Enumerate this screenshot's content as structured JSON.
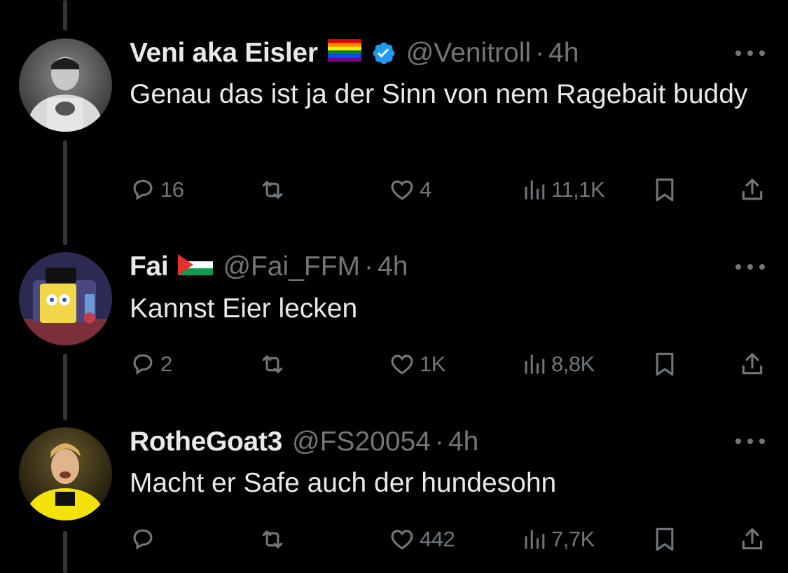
{
  "colors": {
    "background": "#000000",
    "text_primary": "#e7e9ea",
    "text_secondary": "#71767b",
    "verified_blue": "#1d9bf0",
    "thread_line": "#333639"
  },
  "tweets": [
    {
      "display_name": "Veni aka Eisler",
      "badges": [
        "rainbow-flag",
        "verified-badge"
      ],
      "handle": "@Venitroll",
      "separator": "·",
      "time": "4h",
      "text": "Genau das ist ja der Sinn von nem Ragebait buddy",
      "replies": "16",
      "reposts": "",
      "likes": "4",
      "views": "11,1K"
    },
    {
      "display_name": "Fai",
      "badges": [
        "palestine-flag"
      ],
      "handle": "@Fai_FFM",
      "separator": "·",
      "time": "4h",
      "text": "Kannst Eier lecken",
      "replies": "2",
      "reposts": "",
      "likes": "1K",
      "views": "8,8K"
    },
    {
      "display_name": "RotheGoat3",
      "badges": [],
      "handle": "@FS20054",
      "separator": "·",
      "time": "4h",
      "text": "Macht er Safe auch der hundesohn",
      "replies": "",
      "reposts": "",
      "likes": "442",
      "views": "7,7K"
    }
  ]
}
